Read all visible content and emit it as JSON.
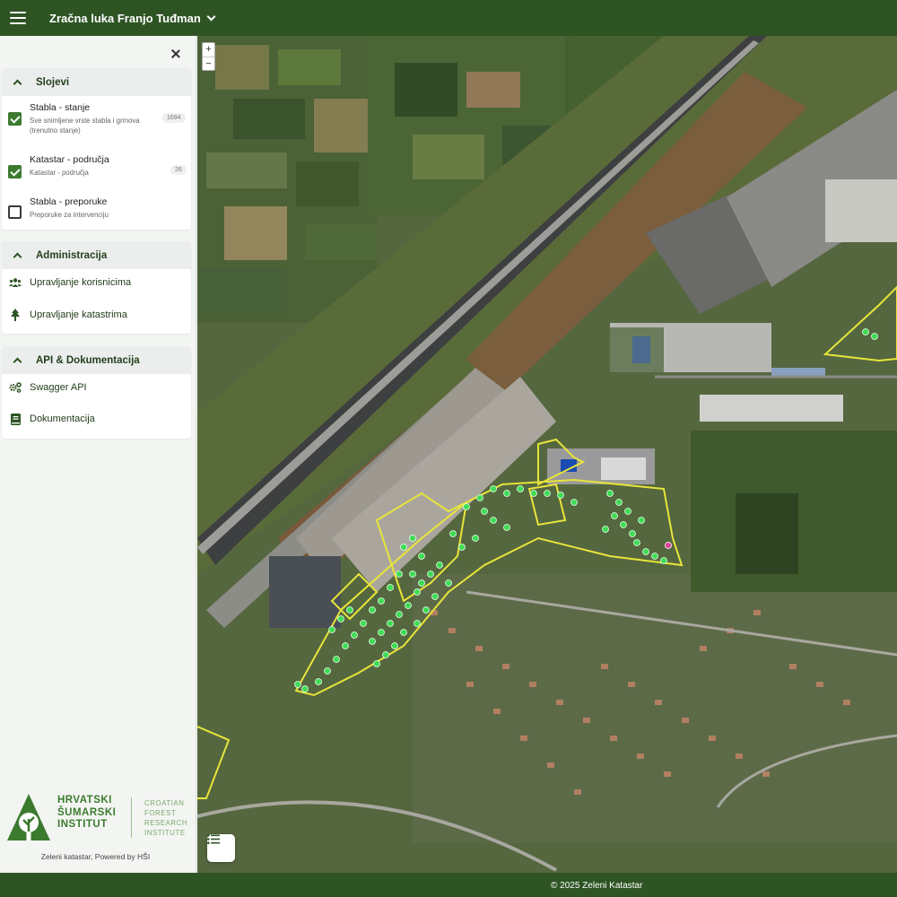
{
  "header": {
    "menu_icon": "hamburger-icon",
    "title": "Zračna luka Franjo Tuđman",
    "title_icon": "chevron-down-icon"
  },
  "sidebar": {
    "close_icon": "close-icon",
    "layers_panel": {
      "title": "Slojevi",
      "items": [
        {
          "name": "Stabla - stanje",
          "sub": "Sve snimljene vrste stabla i grmova (trenutno stanje)",
          "count": "1694",
          "checked": true
        },
        {
          "name": "Katastar - područja",
          "sub": "Katastar - područja",
          "count": "26",
          "checked": true
        },
        {
          "name": "Stabla - preporuke",
          "sub": "Preporuke za intervenciju",
          "count": "",
          "checked": false
        }
      ]
    },
    "admin_panel": {
      "title": "Administracija",
      "items": [
        {
          "label": "Upravljanje korisnicima",
          "icon": "users-icon"
        },
        {
          "label": "Upravljanje katastrima",
          "icon": "tree-icon"
        }
      ]
    },
    "api_panel": {
      "title": "API & Dokumentacija",
      "items": [
        {
          "label": "Swagger API",
          "icon": "gears-icon"
        },
        {
          "label": "Dokumentacija",
          "icon": "book-icon"
        }
      ]
    },
    "logo": {
      "lines": [
        "HRVATSKI",
        "ŠUMARSKI",
        "INSTITUT"
      ],
      "lines_en": [
        "CROATIAN",
        "FOREST",
        "RESEARCH",
        "INSTITUTE"
      ]
    },
    "powered_by": "Zeleni katastar, Powered by HŠI"
  },
  "map": {
    "zoom_in": "+",
    "zoom_out": "−",
    "legend_icon": "list-icon",
    "colors": {
      "cadastre_outline": "#e8e53a",
      "tree_marker": "#3fdc55",
      "tree_recommendation": "#e0409a"
    }
  },
  "footer": {
    "copyright": "© 2025 Zeleni Katastar"
  },
  "colors": {
    "brand_dark_green": "#2e5424",
    "accent_green": "#3c7a2f"
  }
}
